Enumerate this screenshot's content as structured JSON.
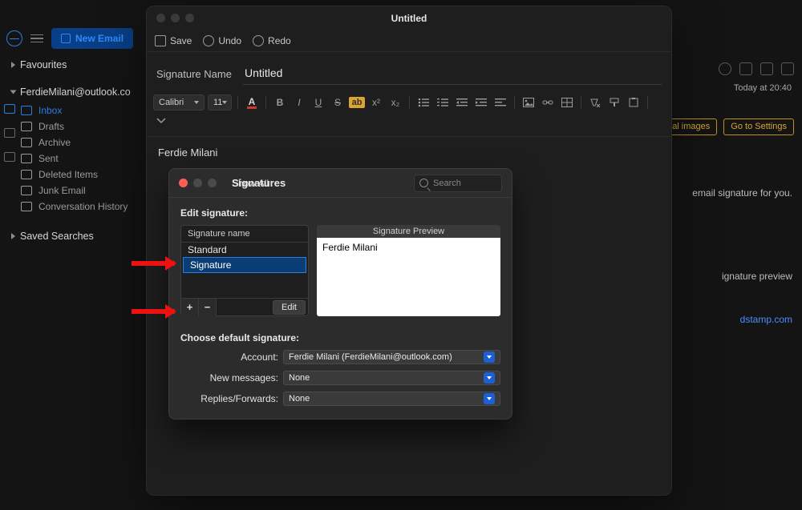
{
  "window": {
    "title": "Untitled"
  },
  "sidebar": {
    "new_email": "New Email",
    "fav_label": "Favourites",
    "account_label": "FerdieMilani@outlook.co",
    "saved_label": "Saved Searches",
    "items": [
      {
        "label": "Inbox"
      },
      {
        "label": "Drafts"
      },
      {
        "label": "Archive"
      },
      {
        "label": "Sent"
      },
      {
        "label": "Deleted Items"
      },
      {
        "label": "Junk Email"
      },
      {
        "label": "Conversation History"
      }
    ]
  },
  "toolbar": {
    "save": "Save",
    "undo": "Undo",
    "redo": "Redo",
    "sig_name_label": "Signature Name",
    "sig_name_value": "Untitled",
    "font_name": "Calibri",
    "font_size": "11"
  },
  "editor": {
    "body_text": "Ferdie Milani"
  },
  "pref": {
    "title": "Signatures",
    "show_all": "Show All",
    "search_placeholder": "Search",
    "edit_label": "Edit signature:",
    "col_header": "Signature name",
    "rows": [
      {
        "name": "Standard"
      },
      {
        "name": "Signature"
      }
    ],
    "add": "+",
    "remove": "−",
    "edit_btn": "Edit",
    "preview_header": "Signature Preview",
    "preview_text": "Ferdie Milani",
    "choose_label": "Choose default signature:",
    "account_label": "Account:",
    "account_value": "Ferdie Milani (FerdieMilani@outlook.com)",
    "newmsg_label": "New messages:",
    "newmsg_value": "None",
    "reply_label": "Replies/Forwards:",
    "reply_value": "None"
  },
  "bg": {
    "time": "Today at 20:40",
    "chip1": "ad external images",
    "chip2": "Go to Settings",
    "text1": "email signature for you.",
    "text2": "ignature preview",
    "link": "dstamp.com"
  }
}
